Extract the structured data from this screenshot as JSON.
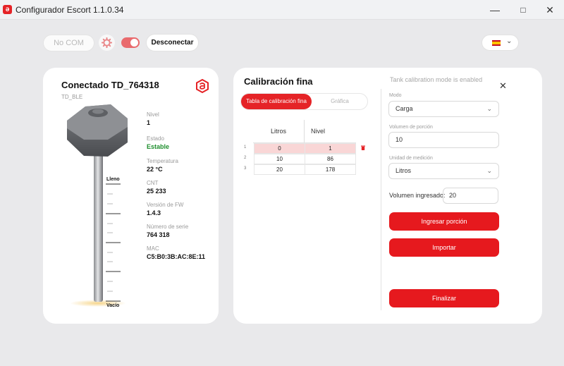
{
  "window": {
    "title": "Configurador Escort 1.1.0.34",
    "app_icon_glyph": "ə"
  },
  "toolbar": {
    "com_port": "No COM",
    "disconnect_label": "Desconectar",
    "toggle_on": true,
    "language": "es",
    "accent_color": "#e52327"
  },
  "device": {
    "title": "Conectado  TD_764318",
    "subtitle": "TD_BLE",
    "info": [
      {
        "label": "Nivel",
        "value": "1"
      },
      {
        "label": "Estado",
        "value": "Estable"
      },
      {
        "label": "Temperatura",
        "value": "22 °C"
      },
      {
        "label": "CNT",
        "value": "25 233"
      },
      {
        "label": "Versión de FW",
        "value": "1.4.3"
      },
      {
        "label": "Número de serie",
        "value": "764 318"
      },
      {
        "label": "MAC",
        "value": "C5:B0:3B:AC:8E:11"
      }
    ],
    "scale_top": "Lleno",
    "scale_bottom": "Vacío"
  },
  "calibration": {
    "title": "Calibración fina",
    "status": "Tank calibration mode is enabled",
    "tabs": {
      "active": "Tabla de calibración fina",
      "inactive": "Gráfica"
    },
    "table": {
      "columns": [
        "Litros",
        "Nivel"
      ],
      "rows": [
        {
          "index": "1",
          "litros": "0",
          "nivel": "1"
        },
        {
          "index": "2",
          "litros": "10",
          "nivel": "86"
        },
        {
          "index": "3",
          "litros": "20",
          "nivel": "178"
        }
      ]
    },
    "form": {
      "mode_label": "Modo",
      "mode_value": "Carga",
      "portion_label": "Volumen de porción",
      "portion_value": "10",
      "unit_label": "Unidad de medición",
      "unit_value": "Litros",
      "entered_label": "Volumen ingresado:",
      "entered_value": "20"
    },
    "buttons": {
      "add_portion": "Ingresar porción",
      "import": "Importar",
      "finish": "Finalizar"
    }
  }
}
